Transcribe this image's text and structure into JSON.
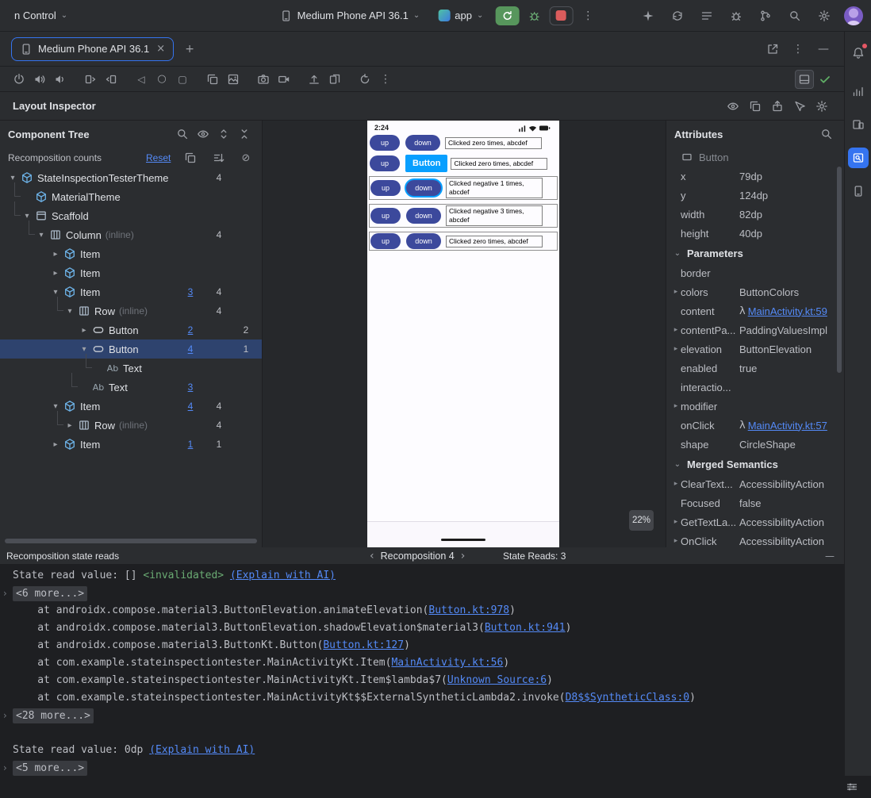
{
  "colors": {
    "accent": "#3574f0",
    "link": "#548af7",
    "selection": "#2e436e",
    "run_green": "#57965c",
    "stop_red": "#db5c5c",
    "component_highlight": "#089fff",
    "invalidated_green": "#6aab73"
  },
  "icons": {
    "more_vert": "⋮",
    "plus": "+",
    "close": "×",
    "minimize": "—",
    "back": "◁",
    "home": "○",
    "overview": "▢",
    "ban_slash": "⊘",
    "chevron_down": "▾",
    "chevron_right": "▸",
    "chevron_down_small": "⌄",
    "nav_prev": "‹",
    "nav_next": "›",
    "lambda": "λ"
  },
  "titlebar": {
    "vcs_widget": "n Control",
    "device": "Medium Phone API 36.1",
    "run_config": "app"
  },
  "tabs": {
    "active": "Medium Phone API 36.1"
  },
  "inspector": {
    "title": "Layout Inspector",
    "component_tree": {
      "title": "Component Tree",
      "recomposition_label": "Recomposition counts",
      "reset_label": "Reset",
      "nodes": [
        {
          "label": "StateInspectionTesterTheme",
          "depth": 0,
          "chev": "down",
          "icon": "compose",
          "c2": "4"
        },
        {
          "label": "MaterialTheme",
          "depth": 1,
          "conn": true,
          "icon": "compose"
        },
        {
          "label": "Scaffold",
          "depth": 1,
          "conn": true,
          "chev": "down",
          "icon": "scaffold"
        },
        {
          "label": "Column",
          "suffix": "(inline)",
          "depth": 2,
          "conn": true,
          "chev": "down",
          "icon": "bars",
          "c2": "4"
        },
        {
          "label": "Item",
          "depth": 3,
          "chev": "right",
          "icon": "compose"
        },
        {
          "label": "Item",
          "depth": 3,
          "chev": "right",
          "icon": "compose"
        },
        {
          "label": "Item",
          "depth": 3,
          "chev": "down",
          "icon": "compose",
          "c1": "3",
          "c2": "4"
        },
        {
          "label": "Row",
          "suffix": "(inline)",
          "depth": 4,
          "conn": true,
          "chev": "down",
          "icon": "bars",
          "c2": "4"
        },
        {
          "label": "Button",
          "depth": 5,
          "chev": "right",
          "icon": "button",
          "c1": "2",
          "c3": "2"
        },
        {
          "label": "Button",
          "depth": 5,
          "chev": "down",
          "icon": "button",
          "c1": "4",
          "c3": "1",
          "selected": true
        },
        {
          "label": "Text",
          "depth": 6,
          "conn": true,
          "icon": "text"
        },
        {
          "label": "Text",
          "depth": 5,
          "conn": true,
          "icon": "text",
          "c1": "3"
        },
        {
          "label": "Item",
          "depth": 3,
          "chev": "down",
          "icon": "compose",
          "c1": "4",
          "c2": "4"
        },
        {
          "label": "Row",
          "suffix": "(inline)",
          "depth": 4,
          "conn": true,
          "chev": "right",
          "icon": "bars",
          "c2": "4"
        },
        {
          "label": "Item",
          "depth": 3,
          "chev": "right",
          "icon": "compose",
          "c1": "1",
          "c2": "1"
        }
      ]
    },
    "preview": {
      "time": "2:24",
      "zoom": "22%",
      "rows": [
        {
          "up": "up",
          "down": "down",
          "text": [
            "Clicked zero times, abcdef"
          ]
        },
        {
          "up": "up",
          "tag": "Button",
          "text": [
            "Clicked zero times, abcdef"
          ]
        },
        {
          "up": "up",
          "down": "down",
          "down_selected": true,
          "box": true,
          "text": [
            "Clicked negative 1 times,",
            "abcdef"
          ]
        },
        {
          "up": "up",
          "down": "down",
          "box": true,
          "text": [
            "Clicked negative 3 times,",
            "abcdef"
          ]
        },
        {
          "up": "up",
          "down": "down",
          "box": true,
          "text": [
            "Clicked zero times, abcdef"
          ]
        }
      ]
    },
    "attributes": {
      "title": "Attributes",
      "component": "Button",
      "rows": [
        {
          "name": "x",
          "value": "79dp"
        },
        {
          "name": "y",
          "value": "124dp"
        },
        {
          "name": "width",
          "value": "82dp"
        },
        {
          "name": "height",
          "value": "40dp"
        },
        {
          "section": "Parameters"
        },
        {
          "name": "border",
          "value": ""
        },
        {
          "name": "colors",
          "chev": true,
          "value": "ButtonColors"
        },
        {
          "name": "content",
          "lambda": true,
          "link": true,
          "value": "MainActivity.kt:59"
        },
        {
          "name": "contentPa...",
          "chev": true,
          "value": "PaddingValuesImpl"
        },
        {
          "name": "elevation",
          "chev": true,
          "value": "ButtonElevation"
        },
        {
          "name": "enabled",
          "value": "true"
        },
        {
          "name": "interactio...",
          "value": ""
        },
        {
          "name": "modifier",
          "chev": true,
          "value": ""
        },
        {
          "name": "onClick",
          "lambda": true,
          "link": true,
          "value": "MainActivity.kt:57"
        },
        {
          "name": "shape",
          "value": "CircleShape"
        },
        {
          "section": "Merged Semantics"
        },
        {
          "name": "ClearText...",
          "chev": true,
          "value": "AccessibilityAction"
        },
        {
          "name": "Focused",
          "value": "false"
        },
        {
          "name": "GetTextLa...",
          "chev": true,
          "value": "AccessibilityAction"
        },
        {
          "name": "OnClick",
          "chev": true,
          "value": "AccessibilityAction"
        }
      ]
    }
  },
  "console": {
    "title": "Recomposition state reads",
    "nav_label": "Recomposition 4",
    "state_reads": "State Reads: 3",
    "lines": [
      {
        "segs": [
          {
            "t": "p",
            "x": "State read value: [] "
          },
          {
            "t": "g",
            "x": "<invalidated>"
          },
          {
            "t": "p",
            "x": " "
          },
          {
            "t": "l",
            "x": "(Explain with AI)"
          }
        ]
      },
      {
        "fold": "<6 more...>"
      },
      {
        "segs": [
          {
            "t": "p",
            "x": "    at androidx.compose.material3.ButtonElevation.animateElevation("
          },
          {
            "t": "l",
            "x": "Button.kt:978"
          },
          {
            "t": "p",
            "x": ")"
          }
        ]
      },
      {
        "segs": [
          {
            "t": "p",
            "x": "    at androidx.compose.material3.ButtonElevation.shadowElevation$material3("
          },
          {
            "t": "l",
            "x": "Button.kt:941"
          },
          {
            "t": "p",
            "x": ")"
          }
        ]
      },
      {
        "segs": [
          {
            "t": "p",
            "x": "    at androidx.compose.material3.ButtonKt.Button("
          },
          {
            "t": "l",
            "x": "Button.kt:127"
          },
          {
            "t": "p",
            "x": ")"
          }
        ]
      },
      {
        "segs": [
          {
            "t": "p",
            "x": "    at com.example.stateinspectiontester.MainActivityKt.Item("
          },
          {
            "t": "l",
            "x": "MainActivity.kt:56"
          },
          {
            "t": "p",
            "x": ")"
          }
        ]
      },
      {
        "segs": [
          {
            "t": "p",
            "x": "    at com.example.stateinspectiontester.MainActivityKt.Item$lambda$7("
          },
          {
            "t": "l",
            "x": "Unknown Source:6"
          },
          {
            "t": "p",
            "x": ")"
          }
        ]
      },
      {
        "segs": [
          {
            "t": "p",
            "x": "    at com.example.stateinspectiontester.MainActivityKt$$ExternalSyntheticLambda2.invoke("
          },
          {
            "t": "l",
            "x": "D8$$SyntheticClass:0"
          },
          {
            "t": "p",
            "x": ")"
          }
        ]
      },
      {
        "fold": "<28 more...>"
      },
      {
        "segs": []
      },
      {
        "segs": [
          {
            "t": "p",
            "x": "State read value: 0dp "
          },
          {
            "t": "l",
            "x": "(Explain with AI)"
          }
        ]
      },
      {
        "fold": "<5 more...>"
      }
    ]
  }
}
